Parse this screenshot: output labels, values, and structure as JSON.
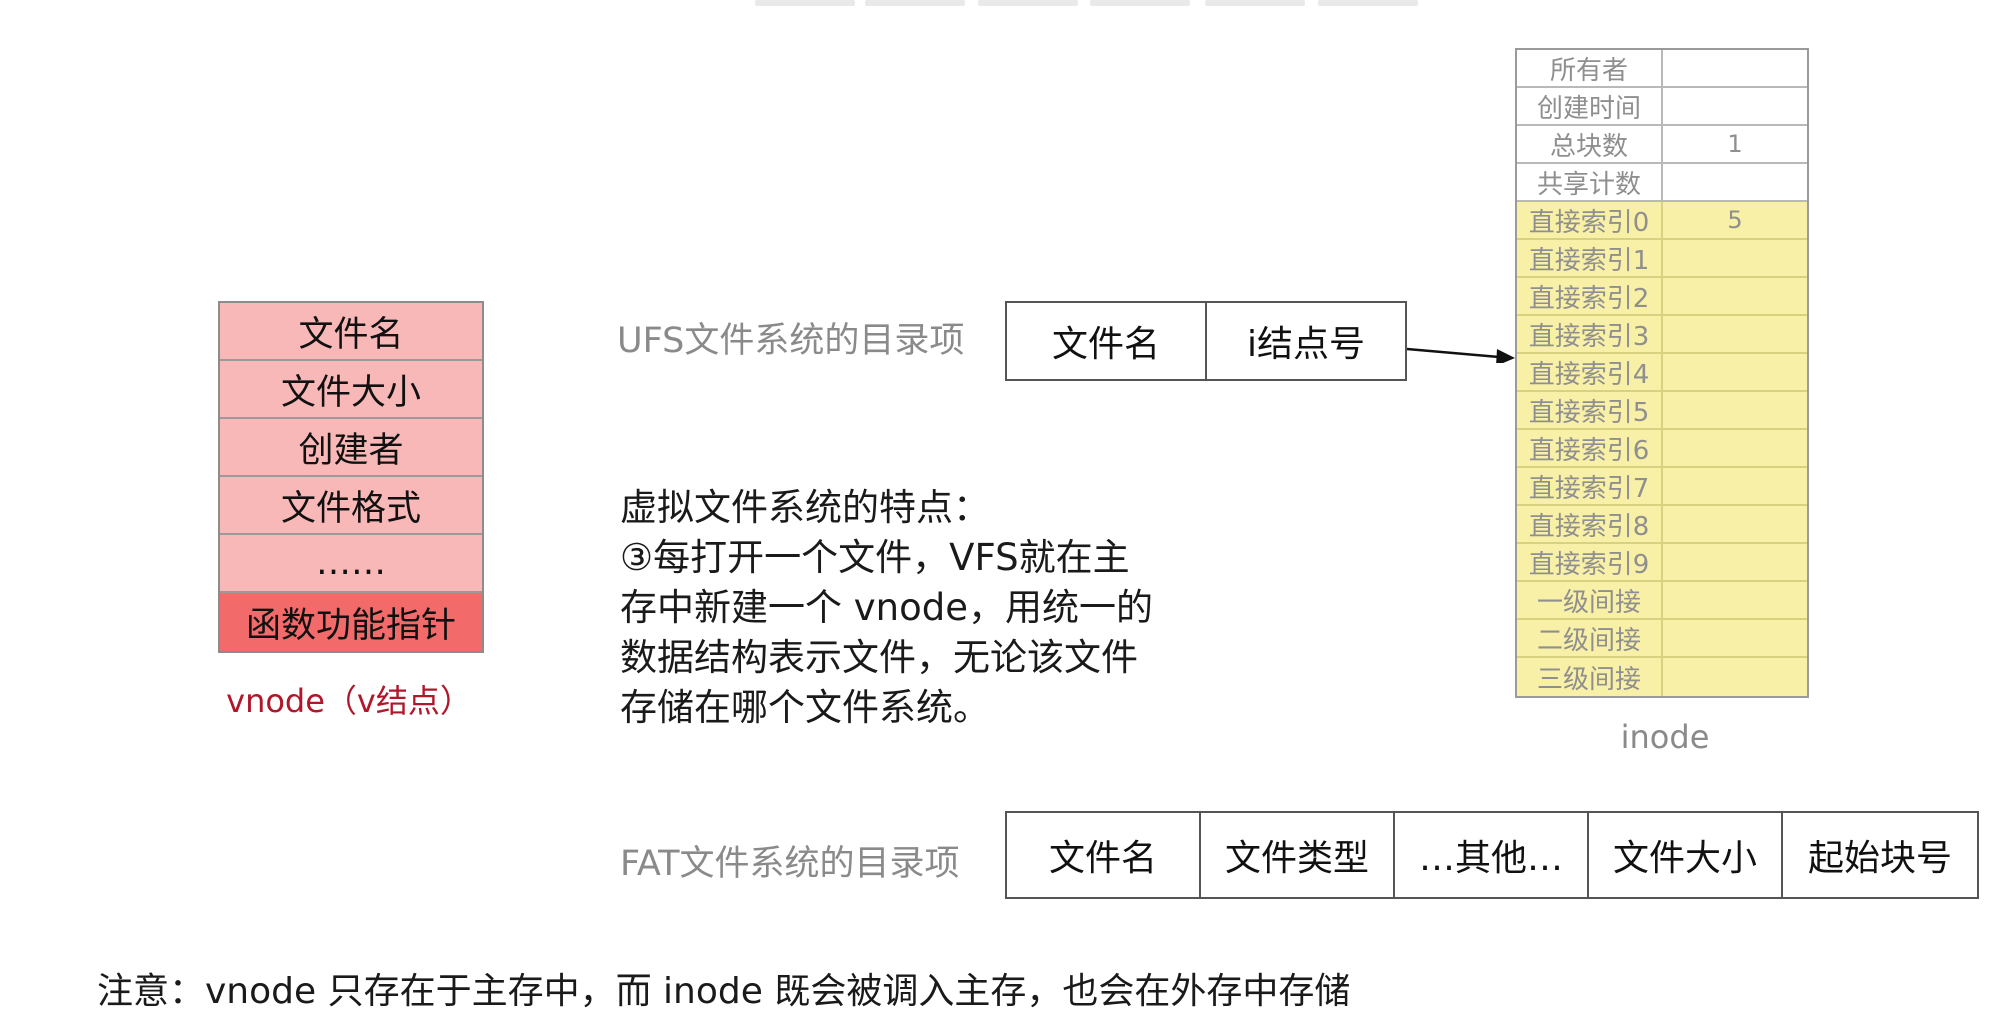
{
  "vnode": {
    "rows": [
      "文件名",
      "文件大小",
      "创建者",
      "文件格式",
      "……",
      "函数功能指针"
    ],
    "caption": "vnode（v结点）"
  },
  "ufs": {
    "label": "UFS文件系统的目录项",
    "cells": [
      "文件名",
      "i结点号"
    ]
  },
  "inode": {
    "rows": [
      {
        "key": "所有者",
        "value": ""
      },
      {
        "key": "创建时间",
        "value": ""
      },
      {
        "key": "总块数",
        "value": "1"
      },
      {
        "key": "共享计数",
        "value": ""
      },
      {
        "key": "直接索引0",
        "value": "5"
      },
      {
        "key": "直接索引1",
        "value": ""
      },
      {
        "key": "直接索引2",
        "value": ""
      },
      {
        "key": "直接索引3",
        "value": ""
      },
      {
        "key": "直接索引4",
        "value": ""
      },
      {
        "key": "直接索引5",
        "value": ""
      },
      {
        "key": "直接索引6",
        "value": ""
      },
      {
        "key": "直接索引7",
        "value": ""
      },
      {
        "key": "直接索引8",
        "value": ""
      },
      {
        "key": "直接索引9",
        "value": ""
      },
      {
        "key": "一级间接",
        "value": ""
      },
      {
        "key": "二级间接",
        "value": ""
      },
      {
        "key": "三级间接",
        "value": ""
      }
    ],
    "caption": "inode"
  },
  "features": {
    "lines": [
      "虚拟文件系统的特点：",
      "③每打开一个文件，VFS就在主",
      "存中新建一个 vnode，用统一的",
      "数据结构表示文件，无论该文件",
      "存储在哪个文件系统。"
    ]
  },
  "fat": {
    "label": "FAT文件系统的目录项",
    "cells": [
      "文件名",
      "文件类型",
      "…其他…",
      "文件大小",
      "起始块号"
    ]
  },
  "note": "注意：vnode 只存在于主存中，而 inode 既会被调入主存，也会在外存中存储",
  "colors": {
    "vnode_row": "#f9b8b8",
    "vnode_func": "#f26a6a",
    "caption_red": "#b0172b",
    "inode_yellow": "#f8f0a6"
  }
}
